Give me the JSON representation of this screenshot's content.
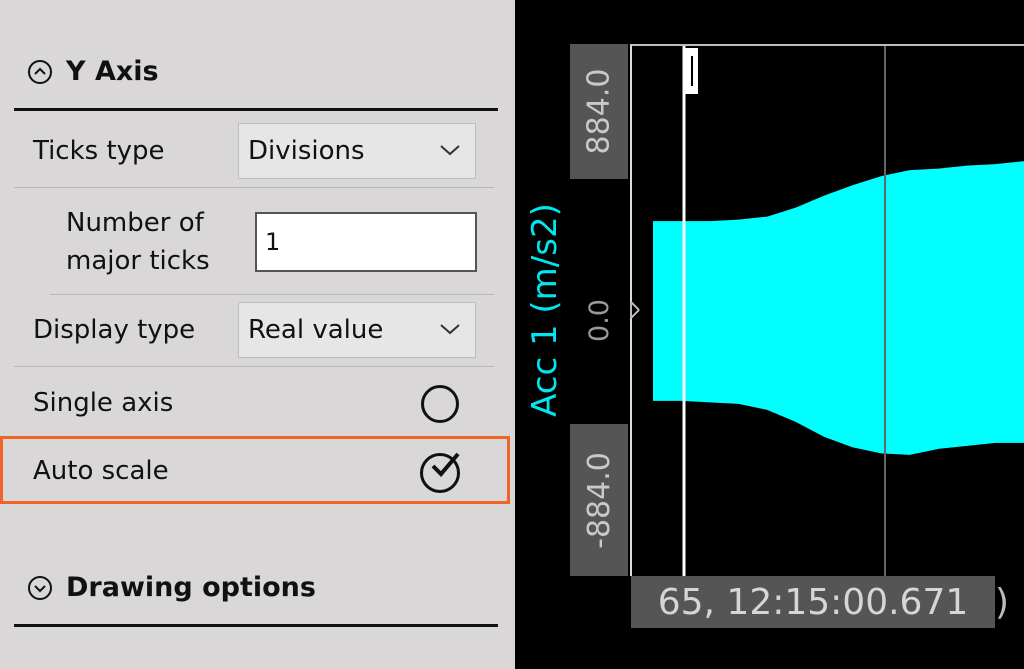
{
  "y_axis_section": {
    "title": "Y Axis",
    "ticks_type": {
      "label": "Ticks type",
      "value": "Divisions"
    },
    "major_ticks": {
      "label_line1": "Number of",
      "label_line2": "major ticks",
      "value": "1"
    },
    "display_type": {
      "label": "Display type",
      "value": "Real value"
    },
    "single_axis": {
      "label": "Single axis",
      "checked": false
    },
    "auto_scale": {
      "label": "Auto scale",
      "checked": true
    }
  },
  "drawing_options_section": {
    "title": "Drawing options"
  },
  "chart": {
    "y_label": "Acc 1 (m/s2)",
    "y_max_label": "884.0",
    "y_zero_label": "0.0",
    "y_min_label": "-884.0",
    "cursor_time": "65, 12:15:00.671",
    "cursor_time_tail": ")",
    "signal_color": "#00ffff",
    "accent_color": "#f06426"
  },
  "chart_data": {
    "type": "area",
    "ylim": [
      -884.0,
      884.0
    ],
    "ylabel": "Acc 1 (m/s2)",
    "series": [
      {
        "name": "Acc 1 (m/s2)",
        "envelope_upper": [
          300,
          300,
          300,
          305,
          315,
          345,
          385,
          420,
          450,
          470,
          475,
          485,
          490,
          500
        ],
        "envelope_lower": [
          -300,
          -300,
          -305,
          -310,
          -330,
          -370,
          -420,
          -455,
          -475,
          -480,
          -460,
          -450,
          -440,
          -440
        ]
      }
    ]
  }
}
